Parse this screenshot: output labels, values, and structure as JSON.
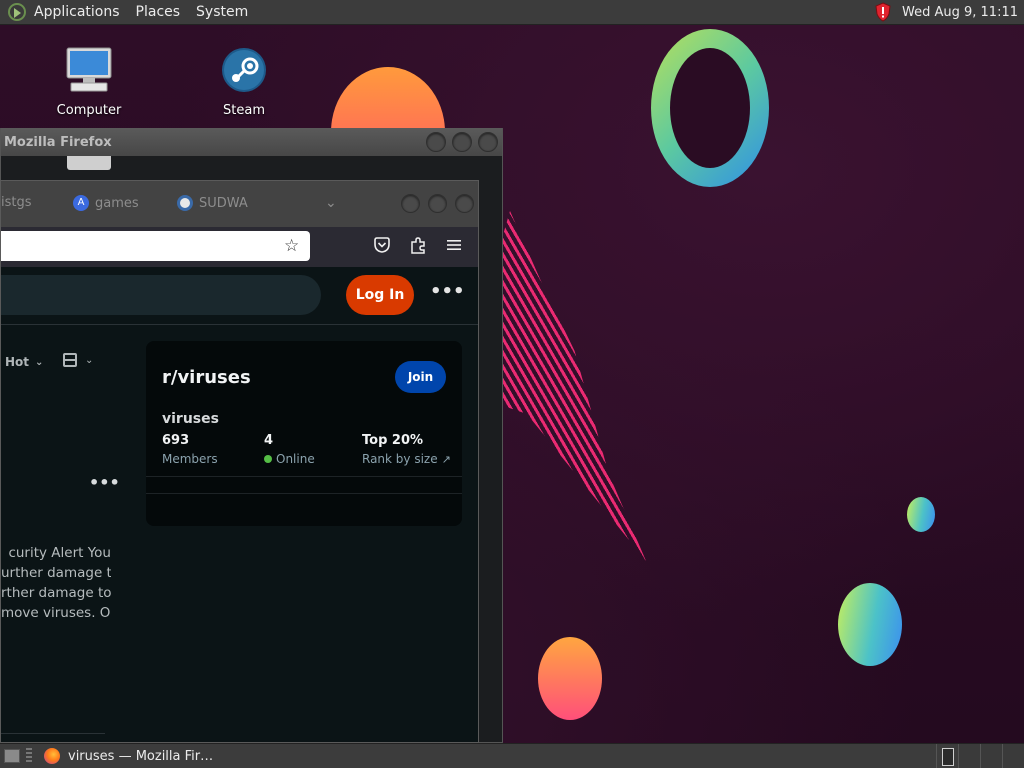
{
  "top_panel": {
    "menus": [
      "Applications",
      "Places",
      "System"
    ],
    "clock": "Wed Aug  9, 11:11"
  },
  "desktop": {
    "icons": [
      {
        "label": "Computer",
        "icon": "computer-icon"
      },
      {
        "label": "Steam",
        "icon": "steam-icon"
      }
    ]
  },
  "back_window": {
    "title": "Mozilla Firefox"
  },
  "browser": {
    "tabs": [
      {
        "label": "istgs"
      },
      {
        "label": "games"
      },
      {
        "label": "SUDWA"
      }
    ],
    "url": ""
  },
  "reddit": {
    "login_label": "Log In",
    "more_label": "•••",
    "sort_label": "Hot",
    "post_dots": "•••",
    "post_lines": [
      "curity Alert You",
      "urther damage to",
      "rther damage to",
      "move viruses. OK"
    ],
    "community": {
      "name": "r/viruses",
      "join_label": "Join",
      "description": "viruses",
      "stats": [
        {
          "value": "693",
          "label": "Members"
        },
        {
          "value": "4",
          "label": "Online"
        },
        {
          "value": "Top 20%",
          "label": "Rank by size"
        }
      ]
    }
  },
  "taskbar": {
    "items": [
      {
        "label": "viruses — Mozilla Fir…",
        "icon": "firefox-icon"
      }
    ]
  },
  "colors": {
    "login": "#d93a00",
    "join": "#0045ac",
    "online": "#55bd46",
    "accent_pink": "#ff2d7a"
  }
}
